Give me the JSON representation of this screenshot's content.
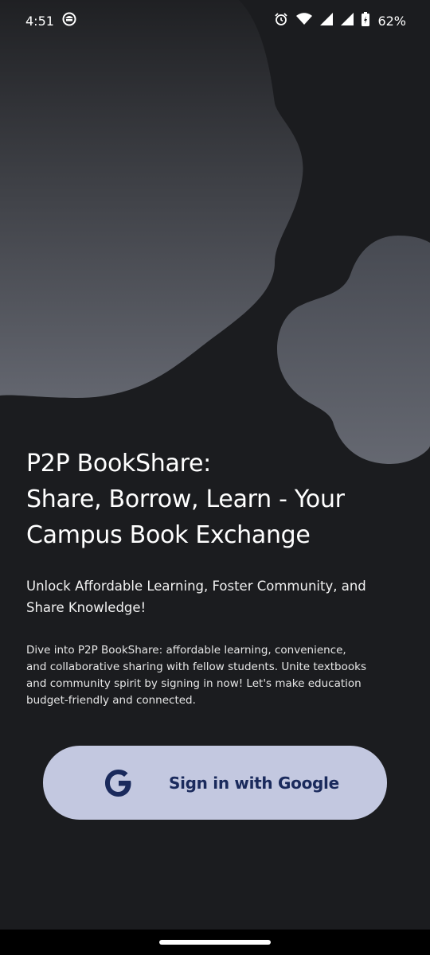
{
  "status_bar": {
    "time": "4:51",
    "battery": "62%",
    "icons": [
      "app-notification-icon",
      "alarm-icon",
      "wifi-icon",
      "signal-icon",
      "signal-icon",
      "battery-charging-icon"
    ]
  },
  "hero": {
    "headline_lines": [
      "P2P BookShare:",
      "Share, Borrow, Learn - Your",
      "Campus Book Exchange"
    ],
    "subtitle_lines": [
      "Unlock Affordable Learning, Foster Community, and",
      "Share Knowledge!"
    ],
    "description_lines": [
      "Dive into P2P BookShare: affordable learning, convenience,",
      "and collaborative sharing with fellow students. Unite textbooks",
      "and community spirit by signing in now! Let's make education",
      "budget-friendly and connected."
    ]
  },
  "signin": {
    "label": "Sign in with Google",
    "icon": "google-icon"
  },
  "colors": {
    "background": "#1b1c1f",
    "button": "#c3c8e0",
    "button_text": "#1a2a5c",
    "blob": "#5c5f68"
  }
}
